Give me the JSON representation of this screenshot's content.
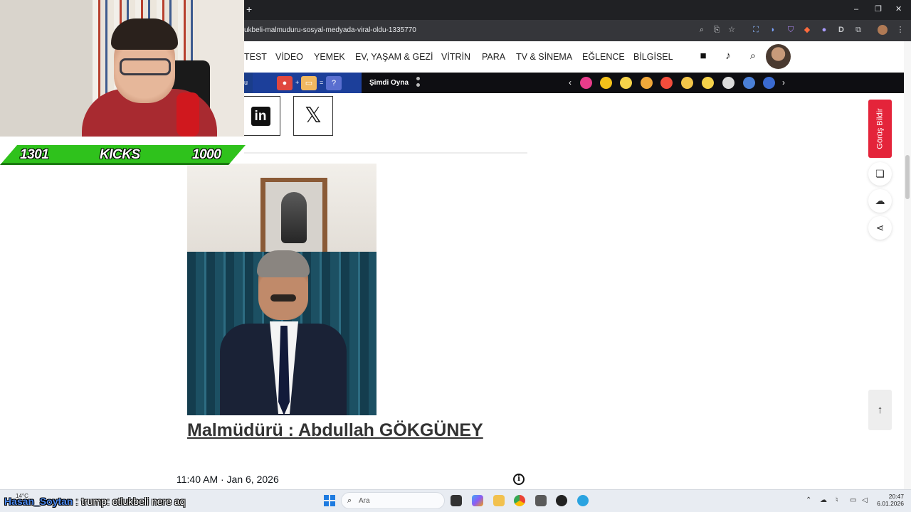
{
  "browser": {
    "new_tab_glyph": "+",
    "window_controls": [
      "–",
      "❐",
      "✕"
    ],
    "url": "ukbeli-malmuduru-sosyal-medyada-viral-oldu-1335770",
    "toolbar_icons": [
      "zoom-icon",
      "install-icon",
      "star-icon",
      "translate-icon",
      "extension-icon",
      "shield-icon",
      "extension-icon",
      "extension-icon",
      "d-extension-icon",
      "puzzle-icon",
      "profile-icon",
      "menu-icon"
    ],
    "toolbar_letter": "D"
  },
  "nav": {
    "items": [
      "TEST",
      "VİDEO",
      "YEMEK",
      "EV, YAŞAM & GEZİ",
      "VİTRİN",
      "PARA",
      "TV & SİNEMA",
      "EĞLENCE",
      "BİLGİSEL"
    ]
  },
  "gamebar": {
    "left_fragment": "u",
    "op_plus": "+",
    "op_equals": "=",
    "question": "?",
    "play_label": "Şimdi Oyna",
    "prev": "‹",
    "next": "›"
  },
  "article": {
    "caption": "Malmüdürü : Abdullah GÖKGÜNEY",
    "tweet_time": "11:40 AM · Jan 6, 2026",
    "info_glyph": "i"
  },
  "rail": {
    "feedback_label": "Görüş Bildir",
    "to_top_glyph": "↑"
  },
  "overlay": {
    "kicks_left": "1301",
    "kicks_label": "KICKS",
    "kicks_right": "1000"
  },
  "chat": {
    "user": "Hasan_Soytan",
    "message": " : trump: otlukbeli nere aq"
  },
  "taskbar": {
    "weather": "14°C",
    "search_placeholder": "Ara",
    "time": "20:47",
    "date": "6.01.2026"
  },
  "colors": {
    "feedback_red": "#e4243a",
    "kicks_green": "#2fc21c",
    "chrome_dark": "#202124"
  }
}
